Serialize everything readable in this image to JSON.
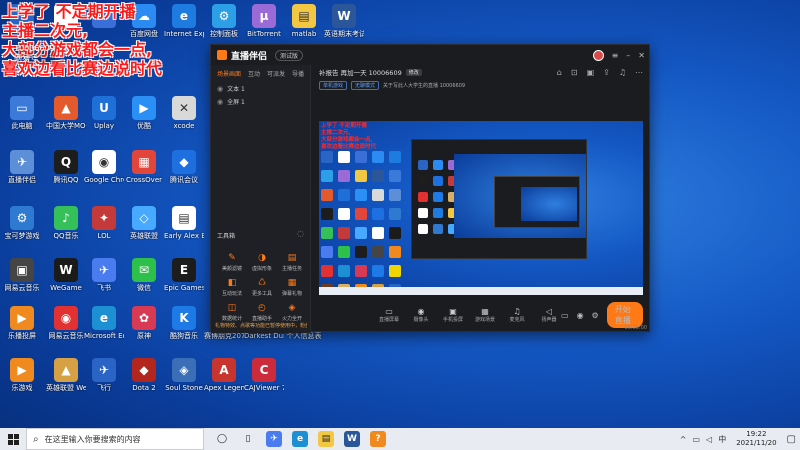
{
  "overlay": {
    "lines": [
      "上学了 不定期开播",
      "主播二次元,",
      "大部分游戏都会一点,",
      "喜欢边看比赛边说时代"
    ],
    "room_number": "10006609",
    "badge": "网易号"
  },
  "desktop_icons": [
    {
      "label": "",
      "col": 0,
      "row": 0,
      "color": "#2a64c5",
      "glyph": ""
    },
    {
      "label": "",
      "col": 1,
      "row": 0,
      "color": "#ffffff",
      "glyph": ""
    },
    {
      "label": "",
      "col": 2,
      "row": 0,
      "color": "#3a6fd8",
      "glyph": ""
    },
    {
      "label": "百度网盘",
      "col": 3,
      "row": 0,
      "color": "#2b8bf2",
      "glyph": "☁"
    },
    {
      "label": "Internet Explorer",
      "col": 4,
      "row": 0,
      "color": "#1e7ce0",
      "glyph": "e"
    },
    {
      "label": "控制面板",
      "col": 5,
      "row": 0,
      "color": "#2d9fe6",
      "glyph": "⚙"
    },
    {
      "label": "BitTorrent",
      "col": 6,
      "row": 0,
      "color": "#9a6ad6",
      "glyph": "µ"
    },
    {
      "label": "matlab",
      "col": 7,
      "row": 0,
      "color": "#f2c744",
      "glyph": "▤"
    },
    {
      "label": "英语期末考试复习",
      "col": 8,
      "row": 0,
      "color": "#2b579a",
      "glyph": "W"
    },
    {
      "label": "此电脑",
      "col": 0,
      "row": 2,
      "color": "#3b7ad8",
      "glyph": "▭"
    },
    {
      "label": "中国大学MOOC",
      "col": 1,
      "row": 2,
      "color": "#e35a2c",
      "glyph": "▲"
    },
    {
      "label": "Uplay",
      "col": 2,
      "row": 2,
      "color": "#1e6fd8",
      "glyph": "U"
    },
    {
      "label": "优酷",
      "col": 3,
      "row": 2,
      "color": "#2b90f5",
      "glyph": "▶"
    },
    {
      "label": "xcode",
      "col": 4,
      "row": 2,
      "color": "#d9d9d9",
      "glyph": "✕"
    },
    {
      "label": "直播伴侣",
      "col": 0,
      "row": 3,
      "color": "#5d8fd8",
      "glyph": "✈"
    },
    {
      "label": "腾讯QQ",
      "col": 1,
      "row": 3,
      "color": "#1d1d1d",
      "glyph": "Q"
    },
    {
      "label": "Google Chrome",
      "col": 2,
      "row": 3,
      "color": "#ffffff",
      "glyph": "◉"
    },
    {
      "label": "CrossOver",
      "col": 3,
      "row": 3,
      "color": "#e2463a",
      "glyph": "▦"
    },
    {
      "label": "腾讯会议",
      "col": 4,
      "row": 3,
      "color": "#1e6fe0",
      "glyph": "◆"
    },
    {
      "label": "宝可梦游戏",
      "col": 0,
      "row": 4,
      "color": "#2f7ad1",
      "glyph": "⚙"
    },
    {
      "label": "QQ音乐",
      "col": 1,
      "row": 4,
      "color": "#36c05a",
      "glyph": "♪"
    },
    {
      "label": "LOL",
      "col": 2,
      "row": 4,
      "color": "#c43a3a",
      "glyph": "✦"
    },
    {
      "label": "英雄联盟",
      "col": 3,
      "row": 4,
      "color": "#47a9ff",
      "glyph": "◇"
    },
    {
      "label": "Early Alex Billion",
      "col": 4,
      "row": 4,
      "color": "#ffffff",
      "glyph": "▤"
    },
    {
      "label": "WeGame",
      "col": 1,
      "row": 5,
      "color": "#1b1b1b",
      "glyph": "W"
    },
    {
      "label": "飞书",
      "col": 2,
      "row": 5,
      "color": "#4a7cf0",
      "glyph": "✈"
    },
    {
      "label": "微信",
      "col": 3,
      "row": 5,
      "color": "#2dc14b",
      "glyph": "✉"
    },
    {
      "label": "Epic Games Launcher",
      "col": 4,
      "row": 5,
      "color": "#1d1d1d",
      "glyph": "E"
    },
    {
      "label": "网易云音乐",
      "col": 0,
      "row": 5,
      "color": "#454545",
      "glyph": "▣"
    },
    {
      "label": "乐播投屏",
      "col": 0,
      "row": 6,
      "color": "#f08a1f",
      "glyph": "▶"
    },
    {
      "label": "网易云音乐",
      "col": 1,
      "row": 6,
      "color": "#e23131",
      "glyph": "◉"
    },
    {
      "label": "Microsoft Edge",
      "col": 2,
      "row": 6,
      "color": "#1d8fd3",
      "glyph": "e"
    },
    {
      "label": "原神",
      "col": 3,
      "row": 6,
      "color": "#d83a54",
      "glyph": "✿"
    },
    {
      "label": "酷狗音乐",
      "col": 4,
      "row": 6,
      "color": "#1e7ae6",
      "glyph": "K"
    },
    {
      "label": "赛博朋克2077",
      "col": 5,
      "row": 6,
      "color": "#f0d600",
      "glyph": "▲"
    },
    {
      "label": "Darkest Dungeon",
      "col": 6,
      "row": 6,
      "color": "#6b3a20",
      "glyph": "▣"
    },
    {
      "label": "个人信息表",
      "col": 7,
      "row": 6,
      "color": "#d7b068",
      "glyph": "▤"
    },
    {
      "label": "乐游戏",
      "col": 0,
      "row": 7,
      "color": "#f08a1f",
      "glyph": "▶"
    },
    {
      "label": "英雄联盟 WeGame版",
      "col": 1,
      "row": 7,
      "color": "#d6a044",
      "glyph": "▲"
    },
    {
      "label": "飞行",
      "col": 2,
      "row": 7,
      "color": "#2a64c5",
      "glyph": "✈"
    },
    {
      "label": "Dota 2",
      "col": 3,
      "row": 7,
      "color": "#b3261e",
      "glyph": "◆"
    },
    {
      "label": "Soul Stone",
      "col": 4,
      "row": 7,
      "color": "#3a6fb8",
      "glyph": "◈"
    },
    {
      "label": "Apex Legends",
      "col": 5,
      "row": 7,
      "color": "#c8342e",
      "glyph": "A"
    },
    {
      "label": "CAJViewer 7.3",
      "col": 6,
      "row": 7,
      "color": "#cc2b3c",
      "glyph": "C"
    }
  ],
  "app": {
    "logo_text": "直播伴侣",
    "version_pill": "测试版",
    "left_tabs": [
      "场景画面",
      "互动",
      "可派发",
      "导播"
    ],
    "scenes": [
      "文本 1",
      "全屏 1"
    ],
    "toolbox_title": "工具箱",
    "tools": [
      {
        "icon": "✎",
        "label": "美颜滤镜"
      },
      {
        "icon": "◑",
        "label": "虚拟形象"
      },
      {
        "icon": "▤",
        "label": "主播任务"
      },
      {
        "icon": "◧",
        "label": "互动玩法"
      },
      {
        "icon": "♺",
        "label": "更多工具"
      },
      {
        "icon": "▦",
        "label": "弹幕礼物"
      },
      {
        "icon": "◫",
        "label": "数据统计"
      },
      {
        "icon": "◴",
        "label": "直播助手"
      },
      {
        "icon": "◈",
        "label": "火力全开"
      }
    ],
    "notice": "礼物特效、点歌等功能已暂停使用中，粉丝体验",
    "room_title": "补报告 再加一天 10006609",
    "edit_label": "修改",
    "chips": [
      "单机游戏",
      "无聊模式"
    ],
    "meta": "关于写此人大学生的直播  10006609",
    "bottom_tools": [
      {
        "icon": "▭",
        "label": "直播屏幕"
      },
      {
        "icon": "◉",
        "label": "摄像头"
      },
      {
        "icon": "▣",
        "label": "手机投屏"
      },
      {
        "icon": "▦",
        "label": "游戏场景"
      },
      {
        "icon": "♫",
        "label": "麦克风"
      },
      {
        "icon": "◁",
        "label": "扬声器"
      }
    ],
    "live_button": "开始直播",
    "status_corner": "00:00:00"
  },
  "preview_overlay": [
    "上学了 不定期开播",
    "主播二次元,",
    "大部分游戏都会一点,",
    "喜欢边看比赛边说时代"
  ],
  "taskbar": {
    "search_placeholder": "在这里输入你要搜索的内容",
    "apps": [
      {
        "glyph": "◯",
        "color": "#ffffff",
        "name": "cortana-icon"
      },
      {
        "glyph": "▯",
        "color": "#ffffff",
        "name": "task-view-icon"
      },
      {
        "glyph": "✈",
        "color": "#4a7cf0",
        "name": "feishu-icon"
      },
      {
        "glyph": "e",
        "color": "#1d8fd3",
        "name": "edge-icon"
      },
      {
        "glyph": "▤",
        "color": "#f2c744",
        "name": "explorer-icon"
      },
      {
        "glyph": "W",
        "color": "#2b579a",
        "name": "word-icon"
      },
      {
        "glyph": "?",
        "color": "#f08a1f",
        "name": "live-assistant-icon"
      }
    ],
    "time": "19:22",
    "date": "2021/11/20",
    "ime": "中"
  }
}
